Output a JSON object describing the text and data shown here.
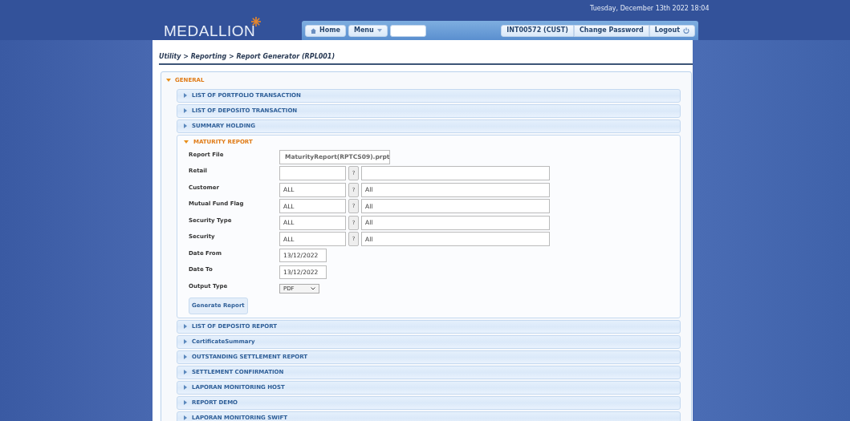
{
  "header": {
    "datetime": "Tuesday, December 13th 2022 18:04",
    "logo": "MEDALLION",
    "nav_left": [
      {
        "label": "Home",
        "kind": "home"
      },
      {
        "label": "Menu",
        "kind": "dropdown"
      },
      {
        "kind": "search"
      }
    ],
    "nav_right": [
      {
        "label": "INT00572 (CUST)",
        "kind": "plain"
      },
      {
        "label": "Change Password",
        "kind": "plain"
      },
      {
        "label": "Logout",
        "kind": "logout"
      }
    ]
  },
  "breadcrumb": "Utility > Reporting > Report Generator (RPL001)",
  "section": {
    "title": "GENERAL",
    "expanded": true,
    "items": [
      {
        "title": "LIST OF PORTFOLIO TRANSACTION",
        "expanded": false
      },
      {
        "title": "LIST OF DEPOSITO TRANSACTION",
        "expanded": false
      },
      {
        "title": "SUMMARY HOLDING",
        "expanded": false
      },
      {
        "title": "MATURITY REPORT",
        "expanded": true,
        "fields": [
          {
            "label": "Report File",
            "kind": "readonly",
            "value": "MaturityReport(RPTCS09).prpt"
          },
          {
            "label": "Retail",
            "kind": "lookup",
            "lookup_button": "?"
          },
          {
            "label": "Customer",
            "kind": "lookup",
            "value": "ALL",
            "lookup_button": "?",
            "description": "All"
          },
          {
            "label": "Mutual Fund Flag",
            "kind": "lookup",
            "value": "ALL",
            "lookup_button": "?",
            "description": "All"
          },
          {
            "label": "Security Type",
            "kind": "lookup",
            "value": "ALL",
            "lookup_button": "?",
            "description": "All"
          },
          {
            "label": "Security",
            "kind": "lookup",
            "value": "ALL",
            "lookup_button": "?",
            "description": "All"
          },
          {
            "label": "Date From",
            "kind": "date",
            "value": "13/12/2022"
          },
          {
            "label": "Date To",
            "kind": "date",
            "value": "13/12/2022"
          },
          {
            "label": "Output Type",
            "kind": "select",
            "value": "PDF"
          }
        ],
        "button": "Generate Report"
      },
      {
        "title": "LIST OF DEPOSITO REPORT",
        "expanded": false
      },
      {
        "title": "CertificateSummary",
        "expanded": false
      },
      {
        "title": "OUTSTANDING SETTLEMENT REPORT",
        "expanded": false
      },
      {
        "title": "SETTLEMENT CONFIRMATION",
        "expanded": false
      },
      {
        "title": "LAPORAN MONITORING HOST",
        "expanded": false
      },
      {
        "title": "REPORT DEMO",
        "expanded": false
      },
      {
        "title": "LAPORAN MONITORING SWIFT",
        "expanded": false
      }
    ]
  }
}
